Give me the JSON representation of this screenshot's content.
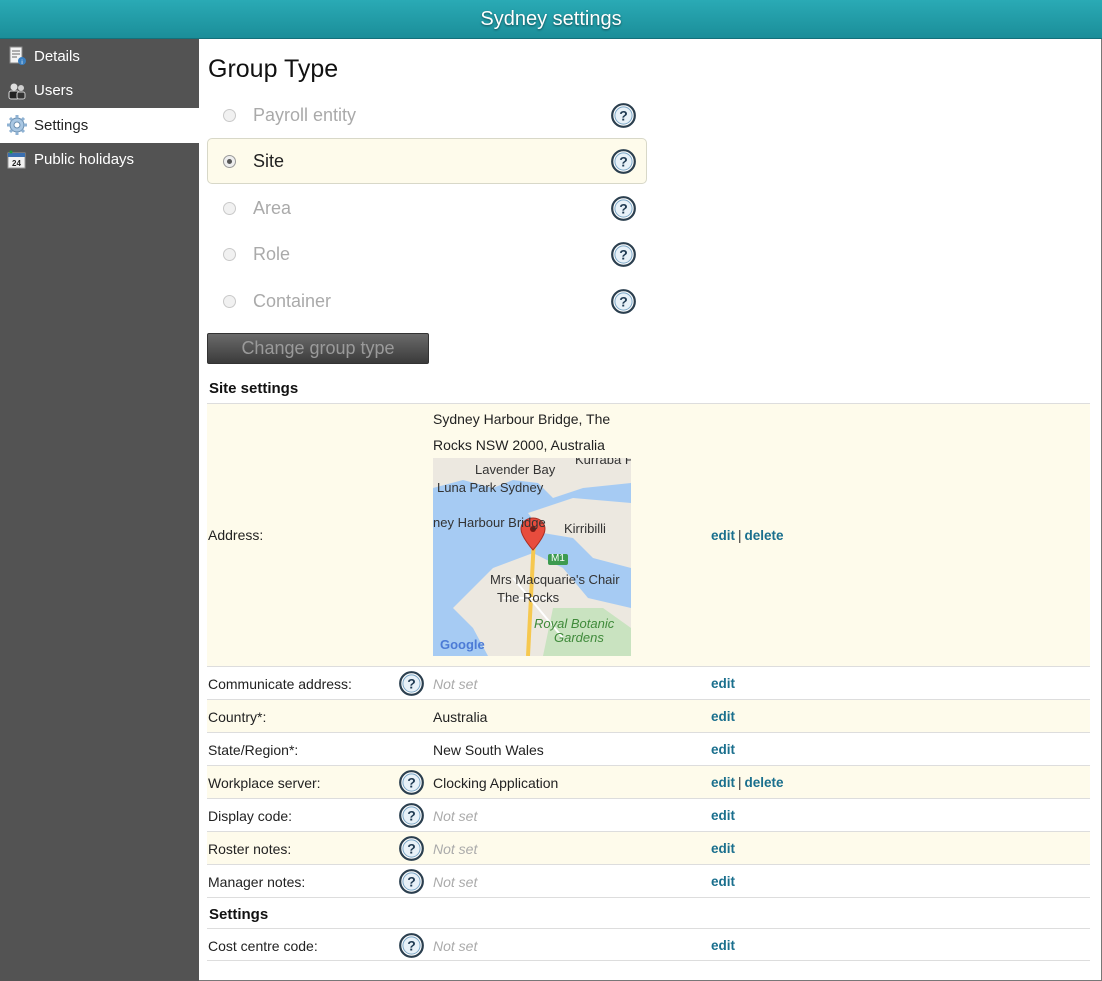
{
  "window": {
    "title": "Sydney settings"
  },
  "sidebar": {
    "items": [
      {
        "label": "Details",
        "icon": "details-icon"
      },
      {
        "label": "Users",
        "icon": "users-icon"
      },
      {
        "label": "Settings",
        "icon": "gear-icon",
        "active": true
      },
      {
        "label": "Public holidays",
        "icon": "calendar-icon"
      }
    ]
  },
  "group_type": {
    "title": "Group Type",
    "options": [
      {
        "label": "Payroll entity",
        "selected": false
      },
      {
        "label": "Site",
        "selected": true
      },
      {
        "label": "Area",
        "selected": false
      },
      {
        "label": "Role",
        "selected": false
      },
      {
        "label": "Container",
        "selected": false
      }
    ],
    "change_button": "Change group type"
  },
  "site_settings": {
    "title": "Site settings",
    "address": {
      "label": "Address:",
      "line1": "Sydney Harbour Bridge, The",
      "line2": "Rocks NSW 2000, Australia",
      "edit": "edit",
      "sep": "|",
      "delete": "delete",
      "map": {
        "labels": [
          "Lavender Bay",
          "Kurraba P",
          "Luna Park Sydney",
          "Kirribilli",
          "ney Harbour Bridge",
          "M1",
          "Mrs Macquarie's Chair",
          "The Rocks",
          "Royal Botanic",
          "Gardens",
          "Google"
        ]
      }
    },
    "rows": [
      {
        "label": "Communicate address:",
        "value": "Not set",
        "edit": "edit"
      },
      {
        "label": "Country*:",
        "value": "Australia",
        "edit": "edit"
      },
      {
        "label": "State/Region*:",
        "value": "New South Wales",
        "edit": "edit"
      },
      {
        "label": "Workplace server:",
        "value": "Clocking Application",
        "edit": "edit",
        "sep": "|",
        "delete": "delete"
      },
      {
        "label": "Display code:",
        "value": "Not set",
        "edit": "edit"
      },
      {
        "label": "Roster notes:",
        "value": "Not set",
        "edit": "edit"
      },
      {
        "label": "Manager notes:",
        "value": "Not set",
        "edit": "edit"
      }
    ]
  },
  "settings": {
    "title": "Settings",
    "rows": [
      {
        "label": "Cost centre code:",
        "value": "Not set",
        "edit": "edit"
      }
    ]
  },
  "colors": {
    "title_bar": "#1b8e99",
    "sidebar": "#535353",
    "row_alt": "#fefbeb",
    "link": "#1a6f8d"
  }
}
